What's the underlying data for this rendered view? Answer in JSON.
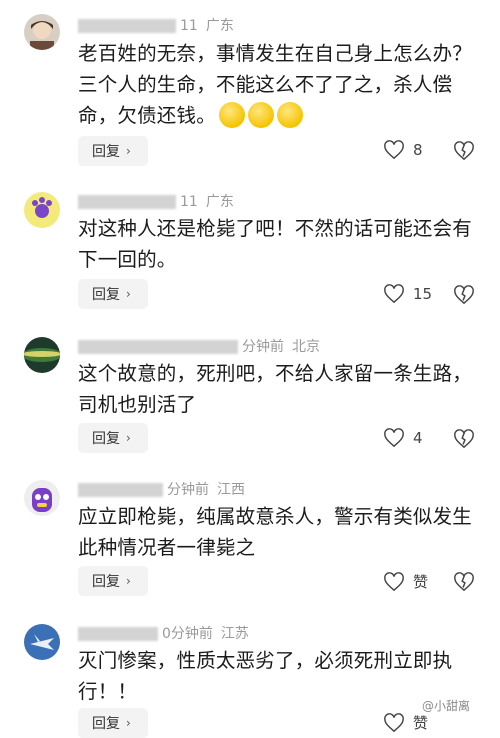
{
  "comments": [
    {
      "meta_tail": "11",
      "location": "广东",
      "text": "老百姓的无奈，事情发生在自己身上怎么办？三个人的生命，不能这么不了了之，杀人偿命，欠债还钱。",
      "emoji": [
        "laugh-emoji",
        "laugh-emoji",
        "laugh-emoji"
      ],
      "reply_label": "回复",
      "like_count": "8"
    },
    {
      "meta_tail": "11",
      "location": "广东",
      "text": "对这种人还是枪毙了吧！不然的话可能还会有下一回的。",
      "reply_label": "回复",
      "like_count": "15"
    },
    {
      "meta_tail": "分钟前",
      "location": "北京",
      "text": "这个故意的，死刑吧，不给人家留一条生路，司机也别活了",
      "reply_label": "回复",
      "like_count": "4"
    },
    {
      "meta_tail": "分钟前",
      "location": "江西",
      "text": "应立即枪毙，纯属故意杀人，警示有类似发生此种情况者一律毙之",
      "reply_label": "回复",
      "like_count": "赞"
    },
    {
      "meta_tail": "0分钟前",
      "location": "江苏",
      "text": "灭门惨案，性质太恶劣了，必须死刑立即执行！！",
      "reply_label": "回复",
      "like_count": "赞"
    }
  ],
  "watermark": "@小甜离",
  "colors": {
    "meta": "#9a9a9a",
    "reply_bg": "#f3f3f3",
    "emoji": "#f5c400"
  }
}
